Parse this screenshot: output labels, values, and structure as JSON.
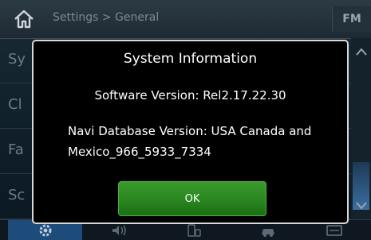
{
  "header": {
    "breadcrumb": "Settings > General",
    "source_label": "FM"
  },
  "background_list": {
    "items": [
      {
        "label": "Sy"
      },
      {
        "label": "Cl"
      },
      {
        "label": "Fa"
      },
      {
        "label": "Sc"
      }
    ]
  },
  "dialog": {
    "title": "System Information",
    "software_version": "Software Version: Rel2.17.22.30",
    "navi_database_line1": "Navi Database Version: USA Canada and",
    "navi_database_line2": "Mexico_966_5933_7334",
    "ok_label": "OK"
  },
  "bottom_tabs": [
    {
      "icon": "gear-icon",
      "active": true
    },
    {
      "icon": "sound-icon",
      "active": false
    },
    {
      "icon": "phone-icon",
      "active": false
    },
    {
      "icon": "vehicle-icon",
      "active": false
    },
    {
      "icon": "display-icon",
      "active": false
    }
  ],
  "colors": {
    "ok_button": "#2d8a22",
    "dialog_border": "#d8d8d8",
    "active_tab": "#1d4c7a"
  }
}
